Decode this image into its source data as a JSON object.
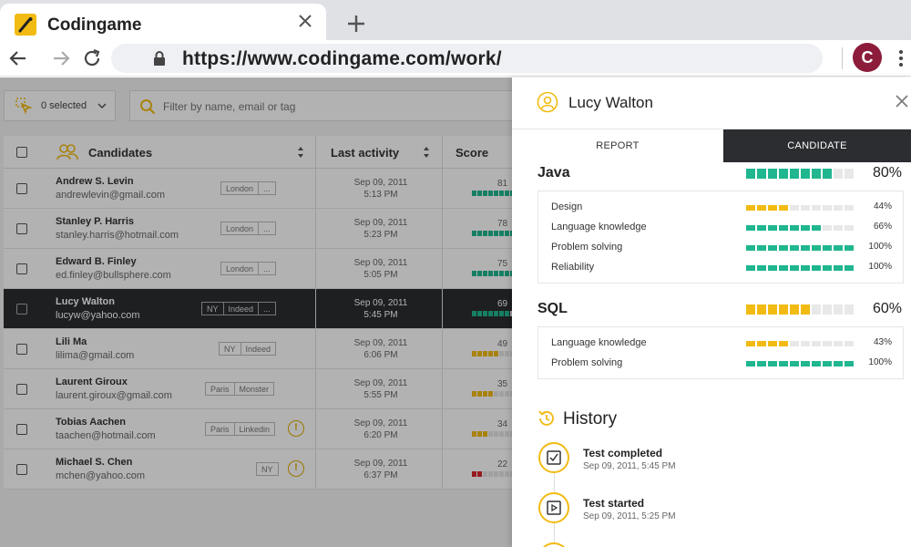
{
  "browser": {
    "tab_title": "Codingame",
    "url": "https://www.codingame.com/work/",
    "profile_initial": "C",
    "profile_color": "#8c1c3a",
    "brand_color": "#f2bb13"
  },
  "toolbar": {
    "selected_label": "0 selected",
    "filter_placeholder": "Filter by name, email or tag"
  },
  "table": {
    "columns": {
      "candidates": "Candidates",
      "last_activity": "Last activity",
      "score": "Score"
    },
    "rows": [
      {
        "name": "Andrew S. Levin",
        "email": "andrewlevin@gmail.com",
        "tags": [
          "London",
          "..."
        ],
        "date": "Sep 09, 2011",
        "time": "5:13 PM",
        "score": "81",
        "warn": false,
        "selected": false
      },
      {
        "name": "Stanley P. Harris",
        "email": "stanley.harris@hotmail.com",
        "tags": [
          "London",
          "..."
        ],
        "date": "Sep 09, 2011",
        "time": "5:23 PM",
        "score": "78",
        "warn": false,
        "selected": false
      },
      {
        "name": "Edward B. Finley",
        "email": "ed.finley@bullsphere.com",
        "tags": [
          "London",
          "..."
        ],
        "date": "Sep 09, 2011",
        "time": "5:05 PM",
        "score": "75",
        "warn": false,
        "selected": false
      },
      {
        "name": "Lucy Walton",
        "email": "lucyw@yahoo.com",
        "tags": [
          "NY",
          "Indeed",
          "..."
        ],
        "date": "Sep 09, 2011",
        "time": "5:45 PM",
        "score": "69",
        "warn": false,
        "selected": true
      },
      {
        "name": "Lili Ma",
        "email": "lilima@gmail.com",
        "tags": [
          "NY",
          "Indeed"
        ],
        "date": "Sep 09, 2011",
        "time": "6:06 PM",
        "score": "49",
        "warn": false,
        "selected": false
      },
      {
        "name": "Laurent Giroux",
        "email": "laurent.giroux@gmail.com",
        "tags": [
          "Paris",
          "Monster"
        ],
        "date": "Sep 09, 2011",
        "time": "5:55 PM",
        "score": "35",
        "warn": false,
        "selected": false
      },
      {
        "name": "Tobias Aachen",
        "email": "taachen@hotmail.com",
        "tags": [
          "Paris",
          "Linkedin"
        ],
        "date": "Sep 09, 2011",
        "time": "6:20 PM",
        "score": "34",
        "warn": true,
        "selected": false
      },
      {
        "name": "Michael S. Chen",
        "email": "mchen@yahoo.com",
        "tags": [
          "NY"
        ],
        "date": "Sep 09, 2011",
        "time": "6:37 PM",
        "score": "22",
        "warn": true,
        "selected": false
      }
    ]
  },
  "panel": {
    "candidate_name": "Lucy Walton",
    "tabs": {
      "report": "REPORT",
      "candidate": "CANDIDATE"
    },
    "skills": [
      {
        "name": "Java",
        "percent": "80%",
        "value": 80,
        "color": "#20b68f",
        "subskills": [
          {
            "label": "Design",
            "percent": "44%",
            "value": 44,
            "color": "#f2bb13"
          },
          {
            "label": "Language knowledge",
            "percent": "66%",
            "value": 66,
            "color": "#20b68f"
          },
          {
            "label": "Problem solving",
            "percent": "100%",
            "value": 100,
            "color": "#20b68f"
          },
          {
            "label": "Reliability",
            "percent": "100%",
            "value": 100,
            "color": "#20b68f"
          }
        ]
      },
      {
        "name": "SQL",
        "percent": "60%",
        "value": 60,
        "color": "#f2bb13",
        "subskills": [
          {
            "label": "Language knowledge",
            "percent": "43%",
            "value": 43,
            "color": "#f2bb13"
          },
          {
            "label": "Problem solving",
            "percent": "100%",
            "value": 100,
            "color": "#20b68f"
          }
        ]
      }
    ],
    "history_title": "History",
    "history": [
      {
        "label": "Test completed",
        "date": "Sep 09, 2011, 5:45 PM",
        "icon": "checkbox-icon"
      },
      {
        "label": "Test started",
        "date": "Sep 09, 2011, 5:25 PM",
        "icon": "play-icon"
      }
    ]
  }
}
